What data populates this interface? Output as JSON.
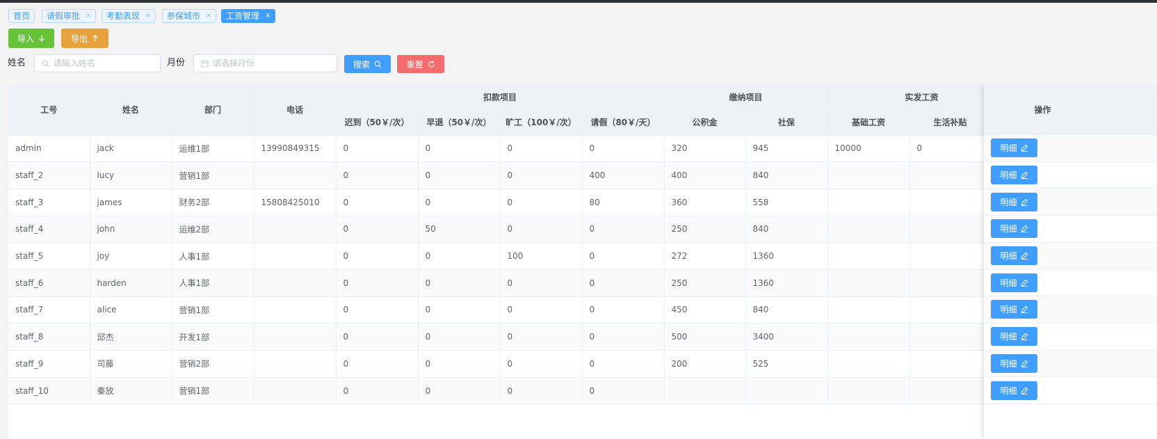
{
  "tags": [
    {
      "label": "首页",
      "closable": false,
      "active": false
    },
    {
      "label": "请假审批",
      "closable": true,
      "active": false
    },
    {
      "label": "考勤表现",
      "closable": true,
      "active": false
    },
    {
      "label": "参保城市",
      "closable": true,
      "active": false
    },
    {
      "label": "工资管理",
      "closable": true,
      "active": true
    }
  ],
  "close_glyph": "×",
  "toolbar": {
    "import_label": "导入",
    "export_label": "导出"
  },
  "filters": {
    "name_label": "姓名",
    "name_placeholder": "请输入姓名",
    "month_label": "月份",
    "month_placeholder": "请选择月份",
    "search_label": "搜索",
    "reset_label": "重置"
  },
  "table": {
    "columns": {
      "id": "工号",
      "name": "姓名",
      "dept": "部门",
      "phone": "电话",
      "deduction_group": "扣款项目",
      "late": "迟到（50￥/次）",
      "early": "早退（50￥/次）",
      "absent": "旷工（100￥/次）",
      "leave": "请假（80￥/天）",
      "payment_group": "缴纳项目",
      "fund": "公积金",
      "social": "社保",
      "actual_group": "实发工资",
      "base": "基础工资",
      "subsidy": "生活补贴",
      "action": "操作"
    },
    "rows": [
      {
        "id": "admin",
        "name": "jack",
        "dept": "运维1部",
        "phone": "13990849315",
        "late": "0",
        "early": "0",
        "absent": "0",
        "leave": "0",
        "fund": "320",
        "social": "945",
        "base": "10000",
        "subsidy": "0"
      },
      {
        "id": "staff_2",
        "name": "lucy",
        "dept": "营销1部",
        "phone": "",
        "late": "0",
        "early": "0",
        "absent": "0",
        "leave": "400",
        "fund": "400",
        "social": "840",
        "base": "",
        "subsidy": ""
      },
      {
        "id": "staff_3",
        "name": "james",
        "dept": "财务2部",
        "phone": "15808425010",
        "late": "0",
        "early": "0",
        "absent": "0",
        "leave": "80",
        "fund": "360",
        "social": "558",
        "base": "",
        "subsidy": ""
      },
      {
        "id": "staff_4",
        "name": "john",
        "dept": "运维2部",
        "phone": "",
        "late": "0",
        "early": "50",
        "absent": "0",
        "leave": "0",
        "fund": "250",
        "social": "840",
        "base": "",
        "subsidy": ""
      },
      {
        "id": "staff_5",
        "name": "joy",
        "dept": "人事1部",
        "phone": "",
        "late": "0",
        "early": "0",
        "absent": "100",
        "leave": "0",
        "fund": "272",
        "social": "1360",
        "base": "",
        "subsidy": ""
      },
      {
        "id": "staff_6",
        "name": "harden",
        "dept": "人事1部",
        "phone": "",
        "late": "0",
        "early": "0",
        "absent": "0",
        "leave": "0",
        "fund": "250",
        "social": "1360",
        "base": "",
        "subsidy": ""
      },
      {
        "id": "staff_7",
        "name": "alice",
        "dept": "营销1部",
        "phone": "",
        "late": "0",
        "early": "0",
        "absent": "0",
        "leave": "0",
        "fund": "450",
        "social": "840",
        "base": "",
        "subsidy": ""
      },
      {
        "id": "staff_8",
        "name": "邱杰",
        "dept": "开发1部",
        "phone": "",
        "late": "0",
        "early": "0",
        "absent": "0",
        "leave": "0",
        "fund": "500",
        "social": "3400",
        "base": "",
        "subsidy": ""
      },
      {
        "id": "staff_9",
        "name": "司藤",
        "dept": "营销2部",
        "phone": "",
        "late": "0",
        "early": "0",
        "absent": "0",
        "leave": "0",
        "fund": "200",
        "social": "525",
        "base": "",
        "subsidy": ""
      },
      {
        "id": "staff_10",
        "name": "秦放",
        "dept": "营销1部",
        "phone": "",
        "late": "0",
        "early": "0",
        "absent": "0",
        "leave": "0",
        "fund": "",
        "social": "",
        "base": "",
        "subsidy": ""
      }
    ],
    "detail_label": "明细"
  },
  "icons": {
    "import": "arrow-down-icon",
    "export": "arrow-up-icon",
    "name_input": "search-icon",
    "month_input": "calendar-icon",
    "search": "search-icon",
    "reset": "refresh-icon",
    "detail": "edit-icon"
  },
  "colors": {
    "primary": "#409eff",
    "success": "#67c23a",
    "warning": "#e6a23c",
    "danger": "#f56c6c",
    "header_bg": "#eef1f6"
  }
}
